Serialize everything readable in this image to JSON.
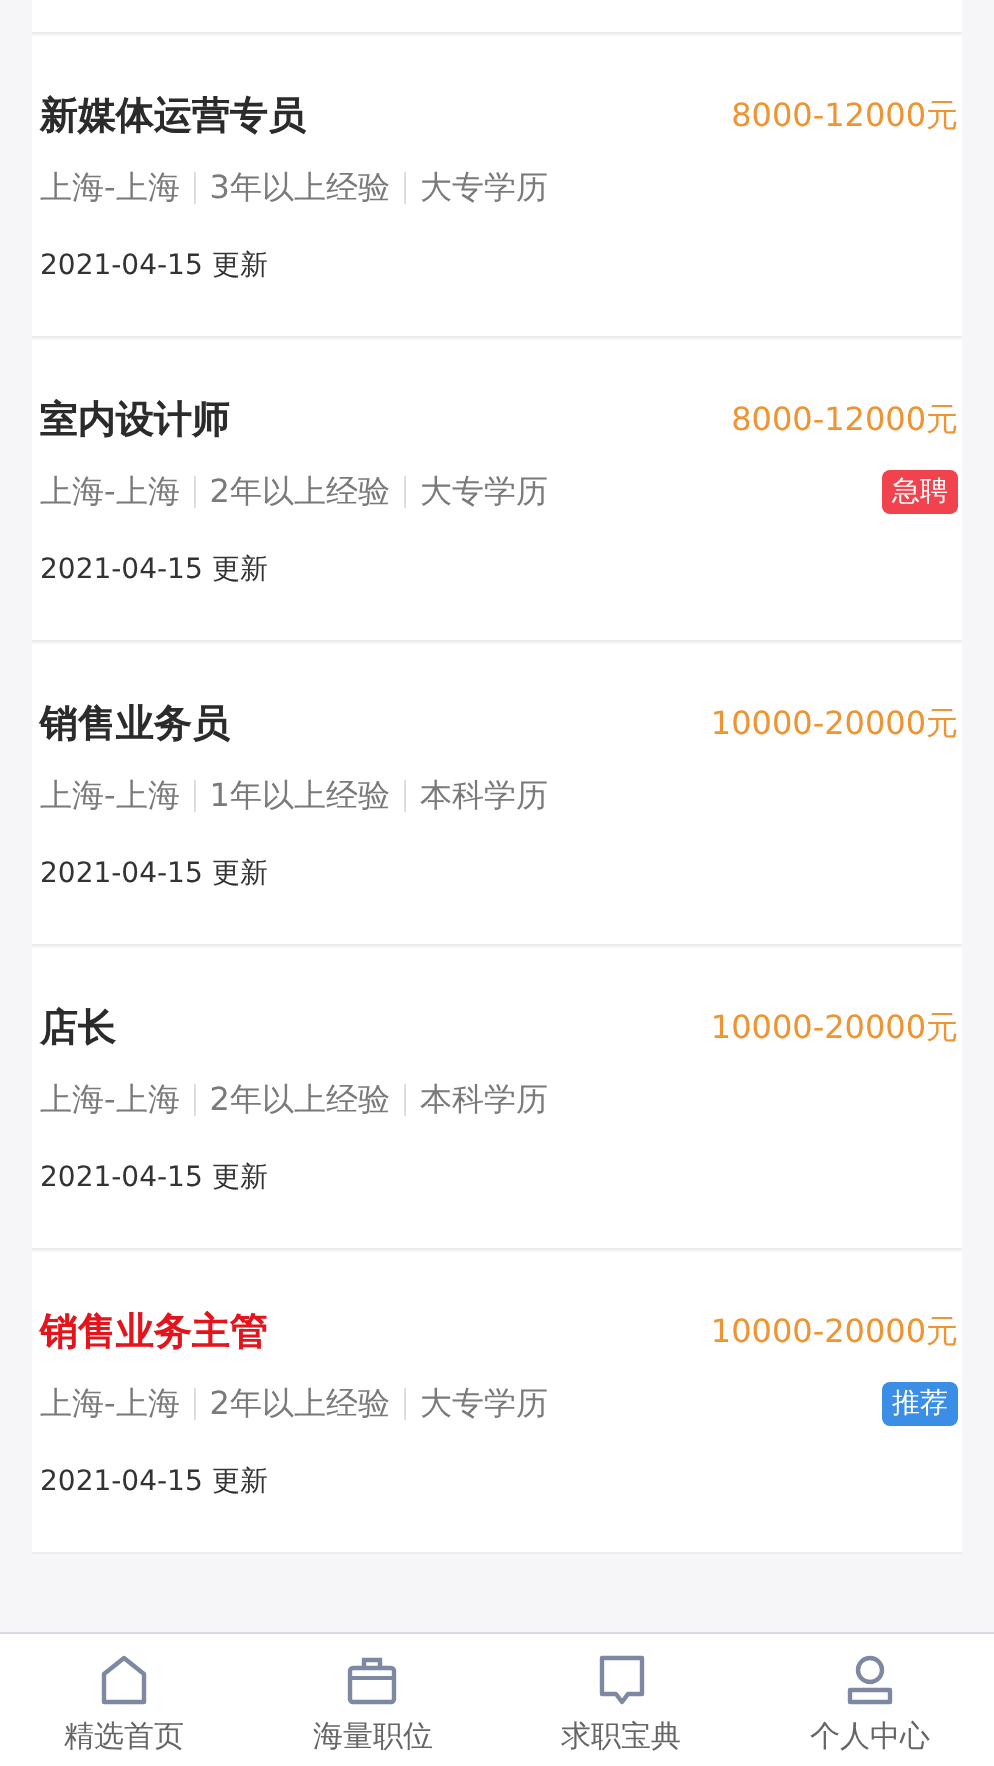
{
  "jobs": [
    {
      "title": "新媒体运营专员",
      "highlight": false,
      "salary": "8000-12000元",
      "tags": [
        "上海-上海",
        "3年以上经验",
        "大专学历"
      ],
      "updated": "2021-04-15 更新"
    },
    {
      "title": "室内设计师",
      "highlight": false,
      "salary": "8000-12000元",
      "tags": [
        "上海-上海",
        "2年以上经验",
        "大专学历"
      ],
      "badge": {
        "text": "急聘",
        "kind": "urgent"
      },
      "updated": "2021-04-15 更新"
    },
    {
      "title": "销售业务员",
      "highlight": false,
      "salary": "10000-20000元",
      "tags": [
        "上海-上海",
        "1年以上经验",
        "本科学历"
      ],
      "updated": "2021-04-15 更新"
    },
    {
      "title": "店长",
      "highlight": false,
      "salary": "10000-20000元",
      "tags": [
        "上海-上海",
        "2年以上经验",
        "本科学历"
      ],
      "updated": "2021-04-15 更新"
    },
    {
      "title": "销售业务主管",
      "highlight": true,
      "salary": "10000-20000元",
      "tags": [
        "上海-上海",
        "2年以上经验",
        "大专学历"
      ],
      "badge": {
        "text": "推荐",
        "kind": "recommend"
      },
      "updated": "2021-04-15 更新"
    }
  ],
  "tab_bar": [
    {
      "label": "精选首页",
      "kind": "home"
    },
    {
      "label": "海量职位",
      "kind": "jobs"
    },
    {
      "label": "求职宝典",
      "kind": "guide"
    },
    {
      "label": "个人中心",
      "kind": "profile"
    }
  ]
}
